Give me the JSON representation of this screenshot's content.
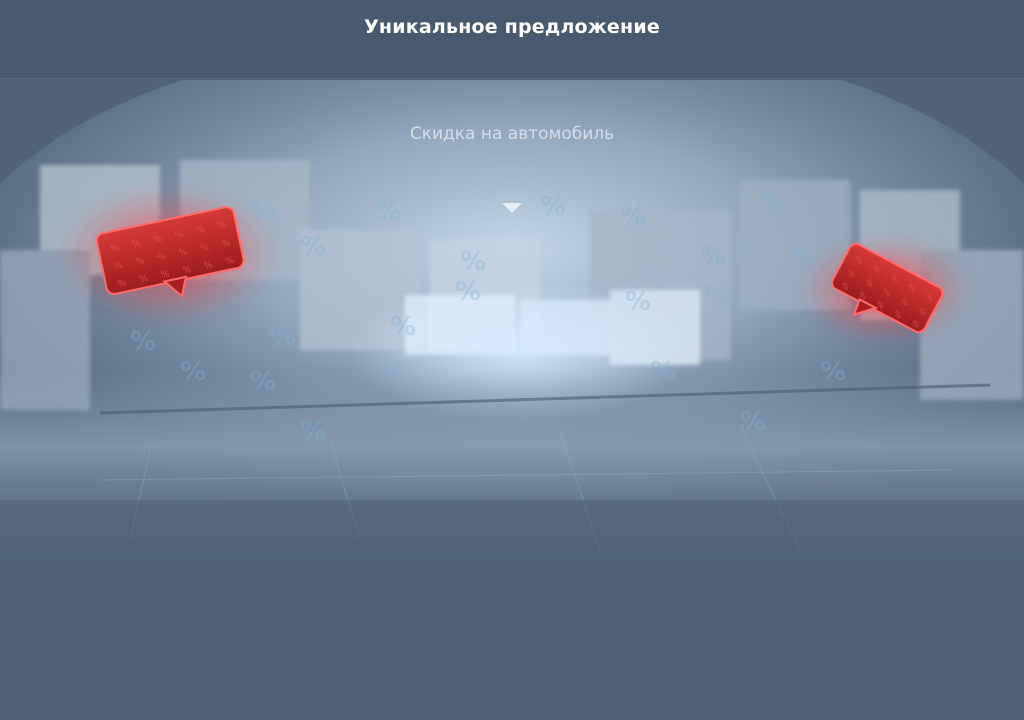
{
  "header": {
    "title": "Уникальное предложение"
  },
  "offer": {
    "label": "Скидка на автомобиль",
    "expand_icon": "chevron-down-icon"
  },
  "scene": {
    "background": "blurred-parking-lot",
    "decorations": [
      "discount-tag-left",
      "discount-tag-right",
      "percent-signs"
    ]
  },
  "colors": {
    "page_background": "#506379",
    "header_background": "#485a70",
    "tag_red": "#c42a2a",
    "glow": "#a9d0f0"
  }
}
